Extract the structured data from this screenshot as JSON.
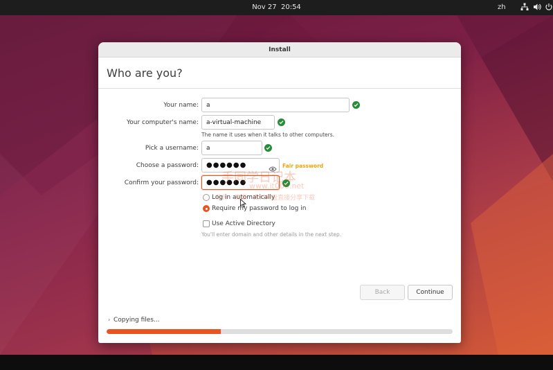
{
  "topbar": {
    "date": "Nov 27",
    "time": "20:54",
    "language": "zh",
    "icons": [
      "network-icon",
      "volume-icon",
      "power-icon"
    ]
  },
  "window": {
    "title": "Install",
    "heading": "Who are you?"
  },
  "form": {
    "your_name_label": "Your name:",
    "your_name_value": "a",
    "computer_name_label": "Your computer's name:",
    "computer_name_value": "a-virtual-machine",
    "computer_name_hint": "The name it uses when it talks to other computers.",
    "username_label": "Pick a username:",
    "username_value": "a",
    "password_label": "Choose a password:",
    "password_value": "●●●●●●",
    "password_strength": "Fair password",
    "confirm_label": "Confirm your password:",
    "confirm_value": "●●●●●●"
  },
  "login": {
    "auto_label": "Log in automatically",
    "require_label": "Require my password to log in",
    "selected": "require"
  },
  "active_directory": {
    "label": "Use Active Directory",
    "checked": false,
    "hint": "You'll enter domain and other details in the next step."
  },
  "buttons": {
    "back": "Back",
    "continue": "Continue"
  },
  "status": {
    "text": "Copying files...",
    "progress": 0.33
  },
  "watermark": {
    "title": "手同学日记本",
    "url": "www.it006.net",
    "tagline": "软件 · 资源 · 资料网盘直接分享下载"
  },
  "colors": {
    "accent": "#e95420",
    "ok": "#2a8c3b",
    "strength": "#f0a30a"
  }
}
